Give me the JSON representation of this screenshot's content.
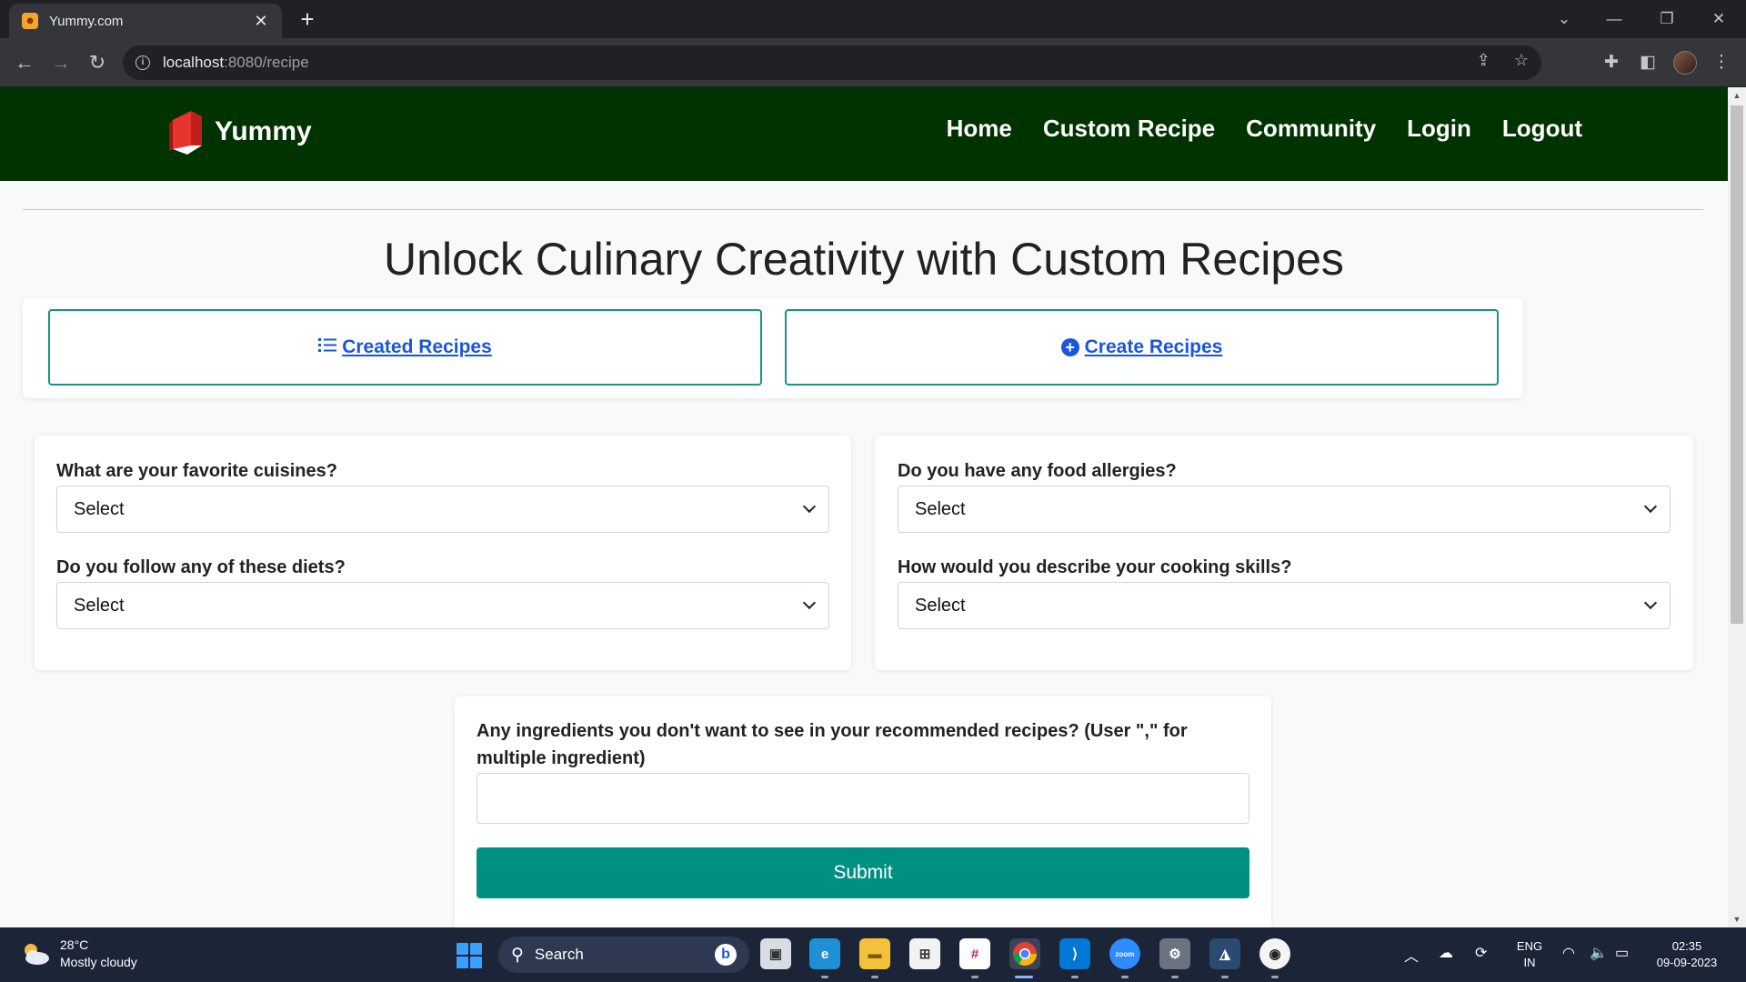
{
  "browser": {
    "tab_title": "Yummy.com",
    "url_host": "localhost",
    "url_path": ":8080/recipe"
  },
  "site": {
    "logo_text": "Yummy",
    "nav": [
      "Home",
      "Custom Recipe",
      "Community",
      "Login",
      "Logout"
    ]
  },
  "page": {
    "title": "Unlock Culinary Creativity with Custom Recipes",
    "created_recipes_link": "Created Recipes",
    "create_recipes_link": "Create Recipes"
  },
  "form": {
    "cuisines_label": "What are your favorite cuisines?",
    "cuisines_value": "Select",
    "allergies_label": "Do you have any food allergies?",
    "allergies_value": "Select",
    "diets_label": "Do you follow any of these diets?",
    "diets_value": "Select",
    "skills_label": "How would you describe your cooking skills?",
    "skills_value": "Select",
    "ingredients_label_line1": "Any ingredients you don't want to see in your recommended recipes? (User \",\" for",
    "ingredients_label_line2": "multiple ingredient)",
    "ingredients_value": "",
    "submit_label": "Submit"
  },
  "taskbar": {
    "weather_temp": "28°C",
    "weather_desc": "Mostly cloudy",
    "search_label": "Search",
    "lang_line1": "ENG",
    "lang_line2": "IN",
    "time": "02:35",
    "date": "09-09-2023"
  },
  "colors": {
    "header_bg": "#003300",
    "accent_teal": "#009081",
    "link_blue": "#1a56db"
  }
}
